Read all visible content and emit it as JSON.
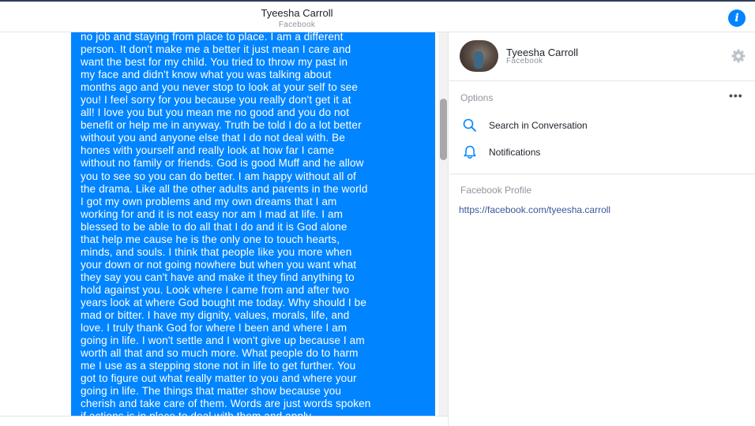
{
  "header": {
    "title": "Tyeesha Carroll",
    "subtitle": "Facebook",
    "info_icon": "info-icon",
    "accent": "#0084ff"
  },
  "conversation": {
    "bubble_color": "#0084ff",
    "lines": [
      "no job and staying from place to place. I am a different",
      "person. It don't make me a better it just mean I care and",
      "want the best for my child. You tried to throw my past in",
      "my face and didn't know what you was talking about",
      "months ago and you never stop to look at your self to see",
      "you! I feel sorry for you because you really don't get it at",
      "all! I love you but you mean me no good and you do not",
      "benefit or help me in anyway. Truth be told I do a lot better",
      "without you and anyone else that I do not deal with. Be",
      "hones with yourself and really look at how far I came",
      "without no family or friends. God is good Muff and he allow",
      "you to see so you can do better. I am happy without all of",
      "the drama. Like all the other adults and parents in the world",
      "I got my own problems and my own dreams that I am",
      "working for and it is not easy nor am I mad at life. I am",
      "blessed to be able to do all that I do and it is God alone",
      "that help me cause he is the only one to touch hearts,",
      "minds, and souls. I think that people like you more when",
      "your down or not going nowhere but when you want what",
      "they say you can't have and make it they find anything to",
      "hold against you. Look where I came from and after two",
      "years look at where God bought me today. Why should I be",
      "mad or bitter. I have my dignity, values, morals, life, and",
      "love. I truly thank God for where I been and where I am",
      "going in life. I won't settle and I won't give up because I am",
      "worth all that and so much more. What people do to harm",
      "me I use as a stepping stone not in life to get further. You",
      "got to figure out what really matter to you and where your",
      "going in life. The things that matter show because you",
      "cherish and take care of them. Words are just words spoken",
      "if actions is in place to deal with them and apply"
    ]
  },
  "panel": {
    "profile": {
      "name": "Tyeesha Carroll",
      "subtitle": "Facebook",
      "avatar_icon": "avatar",
      "settings_icon": "gear-icon"
    },
    "options_title": "Options",
    "more_label": "•••",
    "options": [
      {
        "label": "Search in Conversation",
        "icon": "search-icon"
      },
      {
        "label": "Notifications",
        "icon": "bell-icon"
      }
    ],
    "profile_section_title": "Facebook Profile",
    "profile_link": "https://facebook.com/tyeesha.carroll"
  }
}
